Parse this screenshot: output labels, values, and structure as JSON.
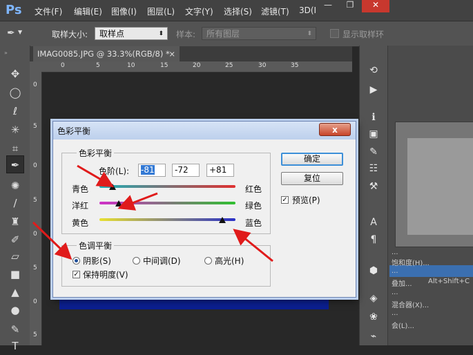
{
  "app": {
    "logo": "Ps",
    "menu": [
      "文件(F)",
      "编辑(E)",
      "图像(I)",
      "图层(L)",
      "文字(Y)",
      "选择(S)",
      "滤镜(T)",
      "3D(I"
    ],
    "window_controls": {
      "minimize": "—",
      "restore": "❐",
      "close": "✕"
    }
  },
  "options_bar": {
    "sample_size_label": "取样大小:",
    "sample_size_value": "取样点",
    "sample_label": "样本:",
    "sample_value": "所有图层",
    "show_ring_label": "显示取样环"
  },
  "document_tab": {
    "title": "IMAG0085.JPG @ 33.3%(RGB/8) *",
    "close": "×"
  },
  "rulers": {
    "horizontal": [
      "0",
      "5",
      "10",
      "15",
      "20",
      "25",
      "30",
      "35"
    ],
    "vertical": [
      "0",
      "5",
      "0",
      "5",
      "0",
      "5",
      "0",
      "5"
    ]
  },
  "dialog": {
    "title": "色彩平衡",
    "close_label": "x",
    "color_balance_legend": "色彩平衡",
    "color_levels_label": "色阶(L):",
    "values": {
      "cyan_red": "-81",
      "magenta_green": "-72",
      "yellow_blue": "+81"
    },
    "sliders": [
      {
        "left": "青色",
        "right": "红色",
        "value": -81
      },
      {
        "left": "洋红",
        "right": "绿色",
        "value": -72
      },
      {
        "left": "黄色",
        "right": "蓝色",
        "value": 81
      }
    ],
    "tone_legend": "色调平衡",
    "tone_options": [
      {
        "label": "阴影(S)",
        "selected": true
      },
      {
        "label": "中间调(D)",
        "selected": false
      },
      {
        "label": "高光(H)",
        "selected": false
      }
    ],
    "preserve_luminosity_label": "保持明度(V)",
    "preserve_luminosity_checked": true,
    "ok_label": "确定",
    "reset_label": "复位",
    "preview_label": "预览(P)",
    "preview_checked": true
  },
  "right_panel": {
    "menu_fragments": [
      "...",
      "饱和度(H)...",
      "...",
      "叠加...",
      "Alt+Shift+C",
      "...",
      "混合器(X)...",
      "...",
      "会(L)..."
    ]
  },
  "colors": {
    "annotation_arrow": "#e01b1b",
    "dialog_title_gradient_top": "#d6e3f6",
    "canvas_image": "#0b1f8f"
  }
}
